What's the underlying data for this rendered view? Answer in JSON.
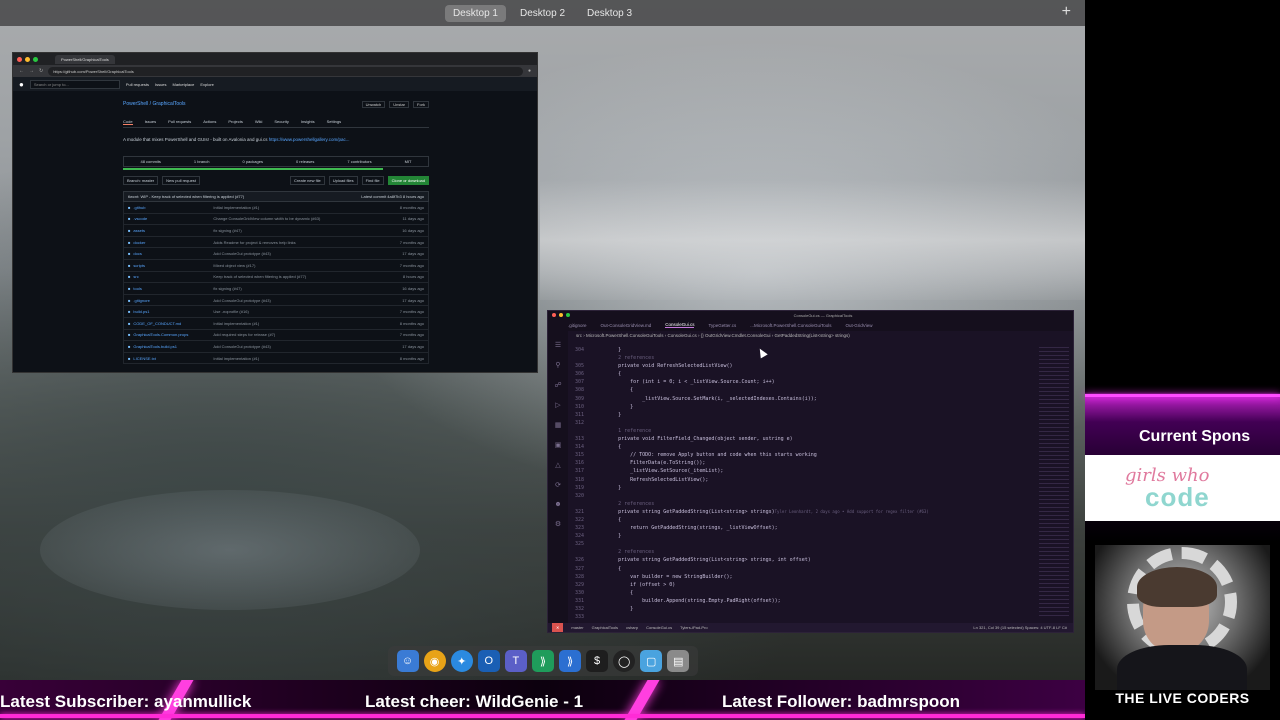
{
  "desktop": {
    "spaces": [
      "Desktop 1",
      "Desktop 2",
      "Desktop 3"
    ],
    "active_space": "Desktop 1",
    "add_icon": "plus-icon"
  },
  "browser": {
    "tab_title": "PowerShell/GraphicalTools",
    "url": "https://github.com/PowerShell/GraphicalTools",
    "search_placeholder": "Search or jump to...",
    "nav": [
      "Pull requests",
      "Issues",
      "Marketplace",
      "Explore"
    ],
    "repo_title": "PowerShell / GraphicalTools",
    "repo_actions": [
      "Unwatch",
      "Unstar",
      "Fork"
    ],
    "tabs": [
      "Code",
      "Issues",
      "Pull requests",
      "Actions",
      "Projects",
      "Wiki",
      "Security",
      "Insights",
      "Settings"
    ],
    "description": "A module that mixes PowerShell and GUIs! - built on Avalonia and gui.cs",
    "link": "https://www.powershellgallery.com/pac...",
    "stats": [
      "48 commits",
      "1 branch",
      "0 packages",
      "0 releases",
      "7 contributors",
      "MIT"
    ],
    "branch": "Branch: master",
    "new_pr": "New pull request",
    "buttons": [
      "Create new file",
      "Upload files",
      "Find file",
      "Clone or download"
    ],
    "latest_commit": "tlwcnt: WIP - Keep track of selected when filtering is applied (#77)",
    "latest_commit_meta": "Latest commit 4a8f7b3 8 hours ago",
    "files": [
      {
        "name": ".github",
        "msg": "Initial implementation (#1)",
        "age": "8 months ago"
      },
      {
        "name": ".vscode",
        "msg": "Change ConsoleGridView column width to be dynamic (#63)",
        "age": "11 days ago"
      },
      {
        "name": "assets",
        "msg": "fix signing (#47)",
        "age": "16 days ago"
      },
      {
        "name": "docker",
        "msg": "Adds Readme for project & removes help links",
        "age": "7 months ago"
      },
      {
        "name": "docs",
        "msg": "Add ConsoleGui prototype (#43)",
        "age": "17 days ago"
      },
      {
        "name": "scripts",
        "msg": "Mixed object view (#17)",
        "age": "7 months ago"
      },
      {
        "name": "src",
        "msg": "Keep track of selected when filtering is applied (#77)",
        "age": "8 hours ago"
      },
      {
        "name": "tools",
        "msg": "fix signing (#47)",
        "age": "16 days ago"
      },
      {
        "name": ".gitignore",
        "msg": "Add ConsoleGui prototype (#43)",
        "age": "17 days ago"
      },
      {
        "name": "build.ps1",
        "msg": "Use -noprofile (#16)",
        "age": "7 months ago"
      },
      {
        "name": "CODE_OF_CONDUCT.md",
        "msg": "Initial implementation (#1)",
        "age": "8 months ago"
      },
      {
        "name": "GraphicalTools.Common.props",
        "msg": "Add required steps for release (#7)",
        "age": "7 months ago"
      },
      {
        "name": "GraphicalTools.build.ps1",
        "msg": "Add ConsoleGui prototype (#43)",
        "age": "17 days ago"
      },
      {
        "name": "LICENSE.txt",
        "msg": "Initial implementation (#1)",
        "age": "8 months ago"
      }
    ]
  },
  "vscode": {
    "title": "ConsoleGui.cs — GraphicalTools",
    "tabs": [
      ".gitignore",
      "Out-ConsoleGridView.md",
      "ConsoleGui.cs",
      "TypeGetter.cs",
      "...Microsoft.PowerShell.ConsoleGuiTools",
      "Out-GridView"
    ],
    "active_tab": "ConsoleGui.cs",
    "breadcrumb": "src › Microsoft.PowerShell.ConsoleGuiTools › ConsoleGui.cs › {} OutGridView.Cmdlet.ConsoleGui › GetPaddedString(List<string> strings)",
    "code": [
      {
        "n": "304",
        "t": "        }"
      },
      {
        "n": "",
        "t": "        2 references"
      },
      {
        "n": "305",
        "t": "        private void RefreshSelectedListView()"
      },
      {
        "n": "306",
        "t": "        {"
      },
      {
        "n": "307",
        "t": "            for (int i = 0; i < _listView.Source.Count; i++)"
      },
      {
        "n": "308",
        "t": "            {"
      },
      {
        "n": "309",
        "t": "                _listView.Source.SetMark(i, _selectedIndexes.Contains(i));"
      },
      {
        "n": "310",
        "t": "            }"
      },
      {
        "n": "311",
        "t": "        }"
      },
      {
        "n": "312",
        "t": ""
      },
      {
        "n": "",
        "t": "        1 reference"
      },
      {
        "n": "313",
        "t": "        private void FilterField_Changed(object sender, ustring e)"
      },
      {
        "n": "314",
        "t": "        {"
      },
      {
        "n": "315",
        "t": "            // TODO: remove Apply button and code when this starts working"
      },
      {
        "n": "316",
        "t": "            FilterData(e.ToString());"
      },
      {
        "n": "317",
        "t": "            _listView.SetSource(_itemList);"
      },
      {
        "n": "318",
        "t": "            RefreshSelectedListView();"
      },
      {
        "n": "319",
        "t": "        }"
      },
      {
        "n": "320",
        "t": ""
      },
      {
        "n": "",
        "t": "        2 references"
      },
      {
        "n": "321",
        "t": "        private string GetPaddedString(List<string> strings)"
      },
      {
        "n": "322",
        "t": "        {"
      },
      {
        "n": "323",
        "t": "            return GetPaddedString(strings, _listViewOffset);"
      },
      {
        "n": "324",
        "t": "        }"
      },
      {
        "n": "325",
        "t": ""
      },
      {
        "n": "",
        "t": "        2 references"
      },
      {
        "n": "326",
        "t": "        private string GetPaddedString(List<string> strings, int offset)"
      },
      {
        "n": "327",
        "t": "        {"
      },
      {
        "n": "328",
        "t": "            var builder = new StringBuilder();"
      },
      {
        "n": "329",
        "t": "            if (offset > 0)"
      },
      {
        "n": "330",
        "t": "            {"
      },
      {
        "n": "331",
        "t": "                builder.Append(string.Empty.PadRight(offset));"
      },
      {
        "n": "332",
        "t": "            }"
      },
      {
        "n": "333",
        "t": ""
      }
    ],
    "hint": "Tyler Leonhardt, 2 days ago • Add support for regex filter (#63)",
    "status_left": [
      "master",
      "GraphicalTools",
      "csharp",
      "ConsoleGui.cs",
      "Tylers-iPad-Pro"
    ],
    "status_right": "Ln 321, Col 39 (15 selected)   Spaces: 4   UTF-8   LF   C#"
  },
  "dock": {
    "icons": [
      "finder-icon",
      "chrome-icon",
      "safari-icon",
      "outlook-icon",
      "teams-icon",
      "vscode-insiders-icon",
      "vscode-icon",
      "terminal-icon",
      "obs-icon",
      "folder-icon",
      "trash-icon"
    ]
  },
  "ticker": {
    "subscriber": "Latest Subscriber: ayanmullick",
    "cheer": "Latest cheer: WildGenie - 1",
    "follower": "Latest Follower: badmrspoon"
  },
  "sidebar": {
    "sponsor_title": "Current Spons",
    "sponsor_logo_a": "girls who",
    "sponsor_logo_b": "code",
    "brand": "THE LIVE CODERS"
  },
  "colors": {
    "accent_neon": "#ff2bd6",
    "github_link": "#58a6ff",
    "github_green": "#238636",
    "vscode_bg": "#1a1225",
    "status_remote": "#d9534f"
  }
}
